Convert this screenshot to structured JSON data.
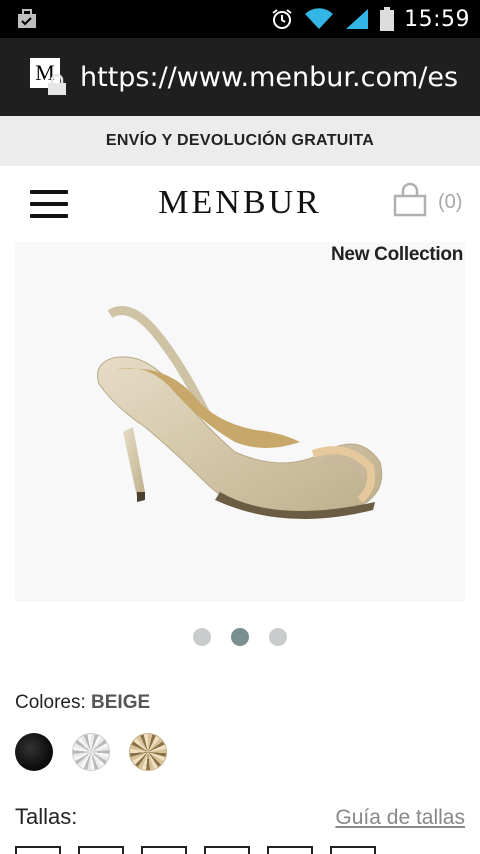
{
  "status_bar": {
    "time": "15:59",
    "icons": [
      "notification-briefcase-icon",
      "alarm-icon",
      "wifi-icon",
      "signal-icon",
      "battery-icon"
    ]
  },
  "browser": {
    "url": "https://www.menbur.com/es",
    "favicon_text": "M"
  },
  "banner": {
    "text": "ENVÍO Y DEVOLUCIÓN GRATUITA"
  },
  "header": {
    "logo": "MENBUR",
    "cart_count": "(0)"
  },
  "product": {
    "badge": "New Collection",
    "carousel": {
      "total": 3,
      "active_index": 1
    }
  },
  "colors": {
    "label": "Colores:",
    "selected": "BEIGE",
    "swatches": [
      "black",
      "silver",
      "beige"
    ]
  },
  "sizes": {
    "label": "Tallas:",
    "guide_link": "Guía de tallas"
  },
  "theme": {
    "accent_dot": "#7a8f8f",
    "muted_text": "#888888"
  }
}
